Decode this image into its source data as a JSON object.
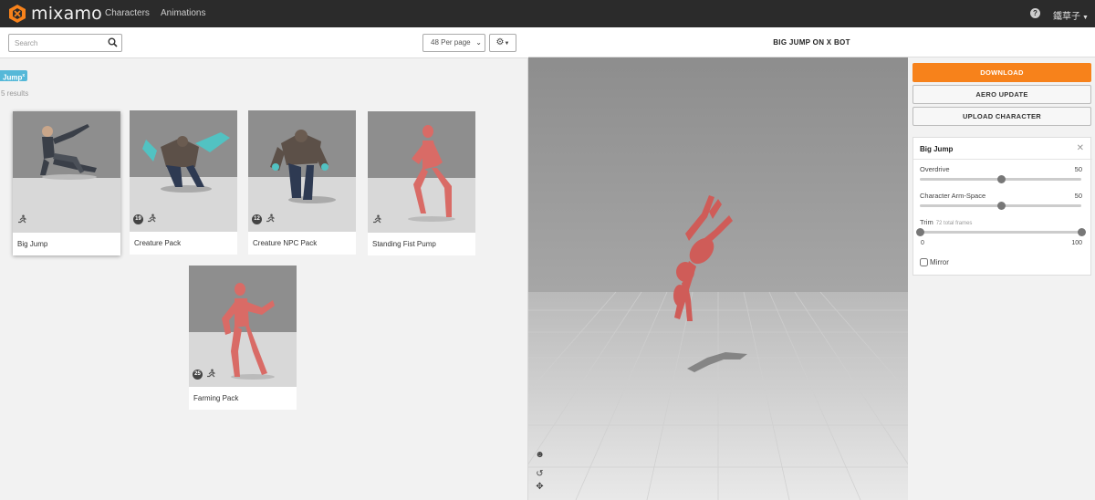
{
  "nav": {
    "logo_text": "mixamo",
    "links": [
      "Characters",
      "Animations"
    ],
    "help_glyph": "?",
    "user_name": "鐵草子"
  },
  "toolbar": {
    "search_placeholder": "Search",
    "per_page": "48 Per page"
  },
  "filter": {
    "tag": "Jump",
    "tag_close": "x",
    "results": "5 results"
  },
  "cards": [
    {
      "label": "Big Jump",
      "count": ""
    },
    {
      "label": "Creature Pack",
      "count": "19"
    },
    {
      "label": "Creature NPC Pack",
      "count": "12"
    },
    {
      "label": "Standing Fist Pump",
      "count": ""
    },
    {
      "label": "Farming Pack",
      "count": "25"
    }
  ],
  "viewport": {
    "title": "BIG JUMP ON X BOT"
  },
  "actions": {
    "download": "DOWNLOAD",
    "aero_update": "AERO UPDATE",
    "upload_character": "UPLOAD CHARACTER"
  },
  "animation": {
    "title": "Big Jump",
    "overdrive_label": "Overdrive",
    "overdrive_value": "50",
    "overdrive_fraction": 0.5,
    "arm_space_label": "Character Arm-Space",
    "arm_space_value": "50",
    "arm_space_fraction": 0.5,
    "trim_label": "Trim",
    "trim_sub": "72 total frames",
    "trim_min": "0",
    "trim_max": "100",
    "mirror_label": "Mirror",
    "mirror_checked": false
  },
  "colors": {
    "accent": "#f7821b",
    "tag": "#55b8d8",
    "topbar": "#2b2b2b"
  },
  "icons": [
    "mixamo-logo-icon",
    "help-icon",
    "search-icon",
    "gear-icon",
    "run-icon",
    "close-icon",
    "face-icon",
    "reset-icon",
    "move-icon"
  ]
}
